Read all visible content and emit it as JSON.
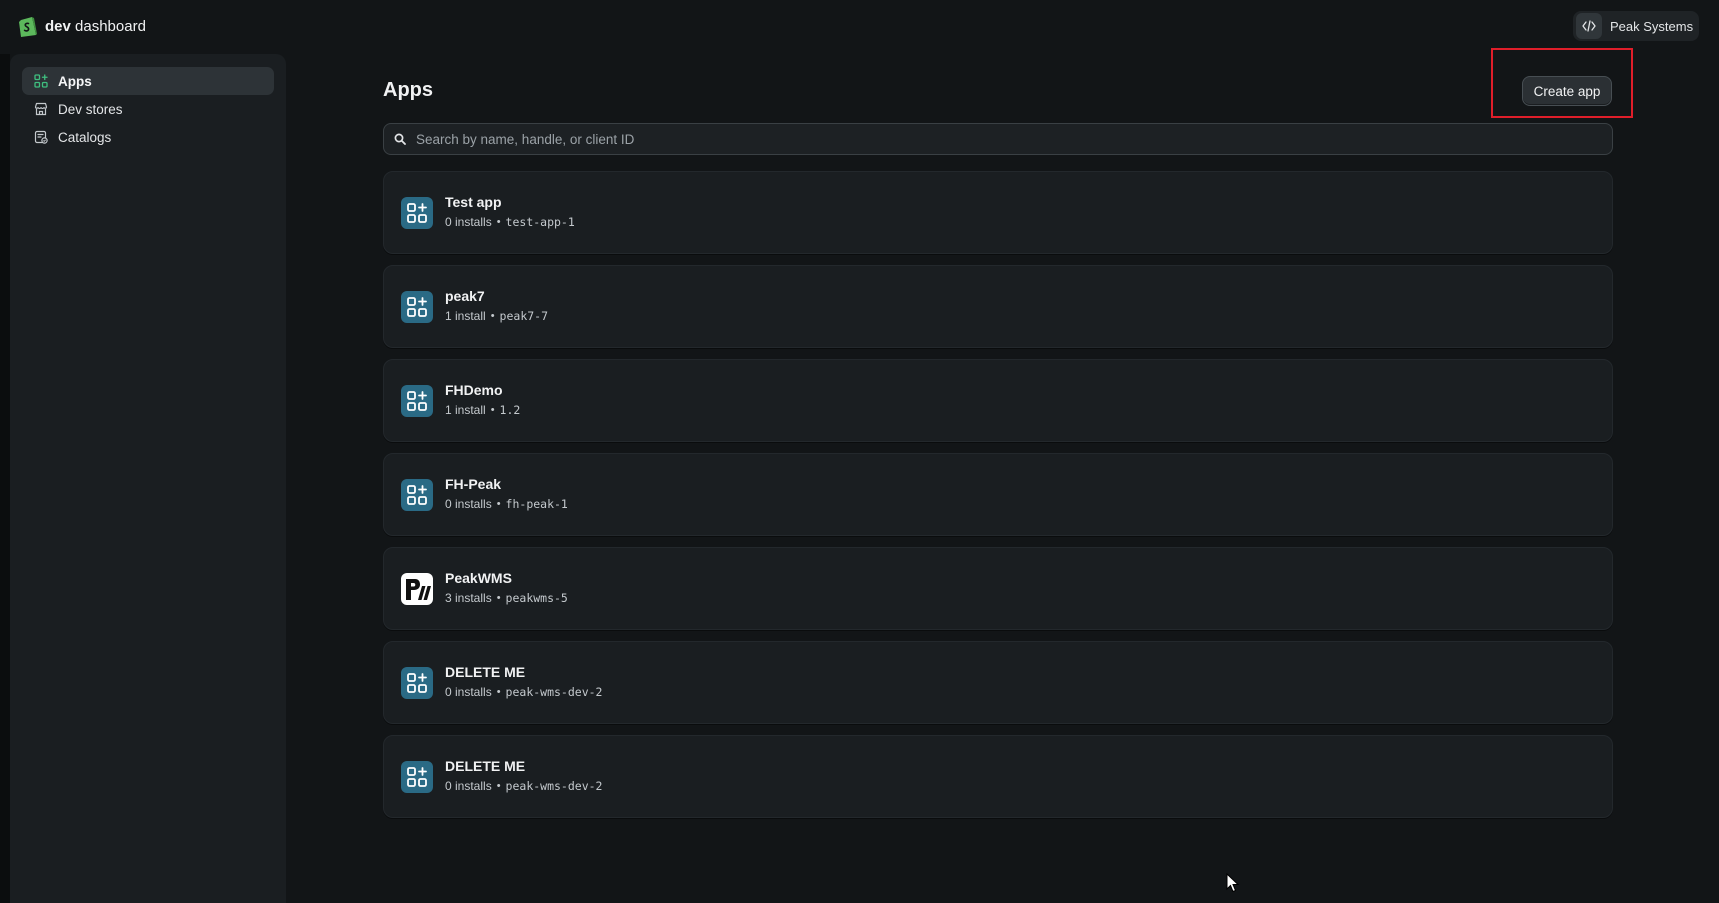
{
  "brand": {
    "bold": "dev",
    "rest": " dashboard"
  },
  "org": {
    "name": "Peak Systems",
    "icon": "code-icon"
  },
  "sidebar": {
    "items": [
      {
        "label": "Apps",
        "icon": "apps-icon",
        "active": true
      },
      {
        "label": "Dev stores",
        "icon": "store-icon",
        "active": false
      },
      {
        "label": "Catalogs",
        "icon": "catalog-icon",
        "active": false
      }
    ]
  },
  "main": {
    "title": "Apps",
    "create_label": "Create app",
    "search_placeholder": "Search by name, handle, or client ID"
  },
  "apps": [
    {
      "name": "Test app",
      "installs": "0 installs",
      "sep": "•",
      "handle": "test-app-1",
      "icon": "app-grid-icon"
    },
    {
      "name": "peak7",
      "installs": "1 install",
      "sep": "•",
      "handle": "peak7-7",
      "icon": "app-grid-icon"
    },
    {
      "name": "FHDemo",
      "installs": "1 install",
      "sep": "•",
      "handle": "1.2",
      "icon": "app-grid-icon"
    },
    {
      "name": "FH-Peak",
      "installs": "0 installs",
      "sep": "•",
      "handle": "fh-peak-1",
      "icon": "app-grid-icon"
    },
    {
      "name": "PeakWMS",
      "installs": "3 installs",
      "sep": "•",
      "handle": "peakwms-5",
      "icon": "peakwms-logo"
    },
    {
      "name": "DELETE ME",
      "installs": "0 installs",
      "sep": "•",
      "handle": "peak-wms-dev-2",
      "icon": "app-grid-icon"
    },
    {
      "name": "DELETE ME",
      "installs": "0 installs",
      "sep": "•",
      "handle": "peak-wms-dev-2",
      "icon": "app-grid-icon"
    }
  ],
  "colors": {
    "accent_highlight": "#e01e2a",
    "app_icon_bg": "#2a6a85",
    "brand_green": "#5cb85c"
  }
}
